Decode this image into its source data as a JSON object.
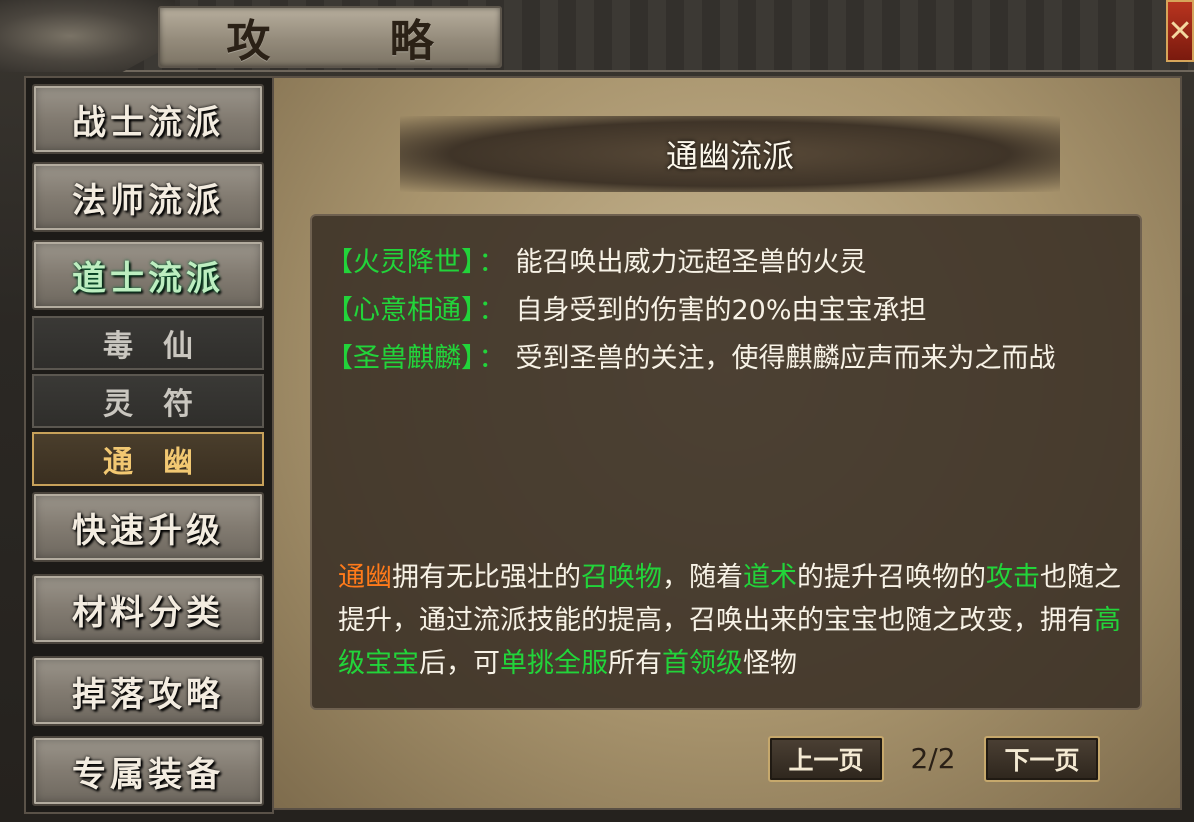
{
  "window": {
    "title": "攻 略",
    "close_label": "✕"
  },
  "sidebar": {
    "items": [
      {
        "label": "战士流派"
      },
      {
        "label": "法师流派"
      },
      {
        "label": "道士流派",
        "active": true
      },
      {
        "label": "快速升级"
      },
      {
        "label": "材料分类"
      },
      {
        "label": "掉落攻略"
      },
      {
        "label": "专属装备"
      }
    ],
    "sub_items": [
      {
        "label": "毒仙"
      },
      {
        "label": "灵符"
      },
      {
        "label": "通幽",
        "selected": true
      }
    ]
  },
  "content": {
    "banner_title": "通幽流派",
    "skills": [
      {
        "name": "【火灵降世】",
        "colon": "：",
        "desc": "能召唤出威力远超圣兽的火灵"
      },
      {
        "name": "【心意相通】",
        "colon": "：",
        "desc": "自身受到的伤害的20%由宝宝承担"
      },
      {
        "name": "【圣兽麒麟】",
        "colon": "：",
        "desc": "受到圣兽的关注，使得麒麟应声而来为之而战"
      }
    ],
    "description": {
      "p1": "通幽",
      "p2": "拥有无比强壮的",
      "p3": "召唤物",
      "p4": "，随着",
      "p5": "道术",
      "p6": "的提升召唤物的",
      "p7": "攻击",
      "p8": "也随之提升，通过流派技能的提高，召唤出来的宝宝也随之改变，拥有",
      "p9": "高级宝宝",
      "p10": "后，可",
      "p11": "单挑全服",
      "p12": "所有",
      "p13": "首领级",
      "p14": "怪物"
    }
  },
  "pagination": {
    "prev_label": "上一页",
    "next_label": "下一页",
    "page_text": "2/2"
  },
  "colors": {
    "highlight_green": "#22d43a",
    "highlight_orange": "#ff7a1a",
    "text_light": "#f7f2e6"
  }
}
